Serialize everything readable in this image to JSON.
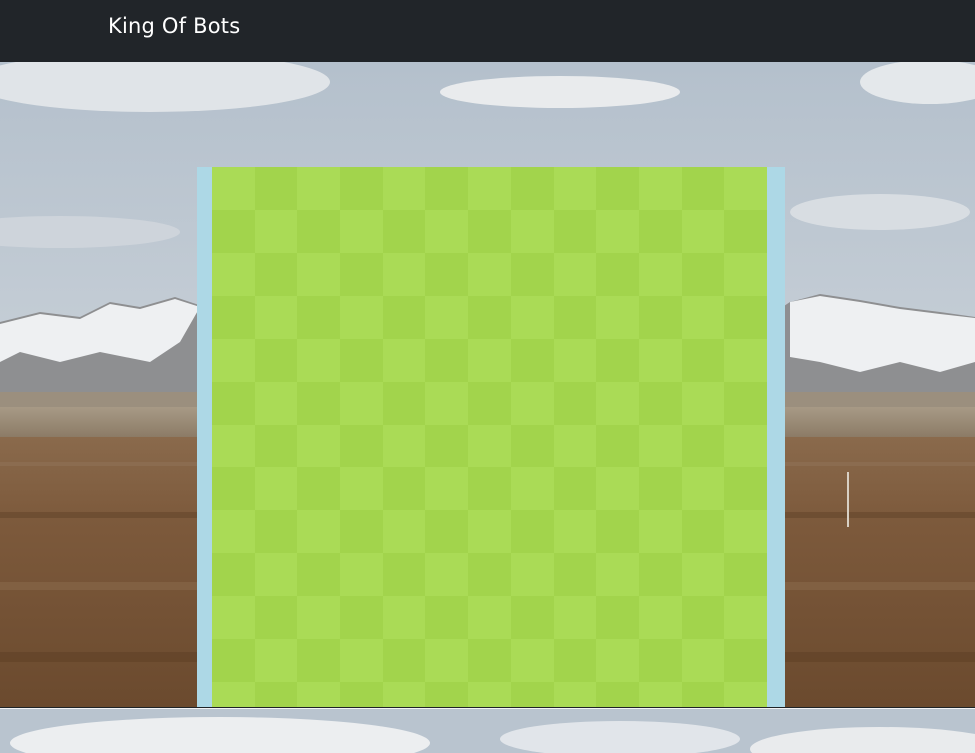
{
  "navbar": {
    "brand": "King Of Bots"
  },
  "board": {
    "rows": 13,
    "cols": 13,
    "colors": {
      "frame": "#add8e6",
      "cell_light": "#aadb56",
      "cell_dark": "#a2d44c"
    }
  },
  "colors": {
    "navbar_bg": "#212529",
    "brand_text": "#ffffff"
  }
}
